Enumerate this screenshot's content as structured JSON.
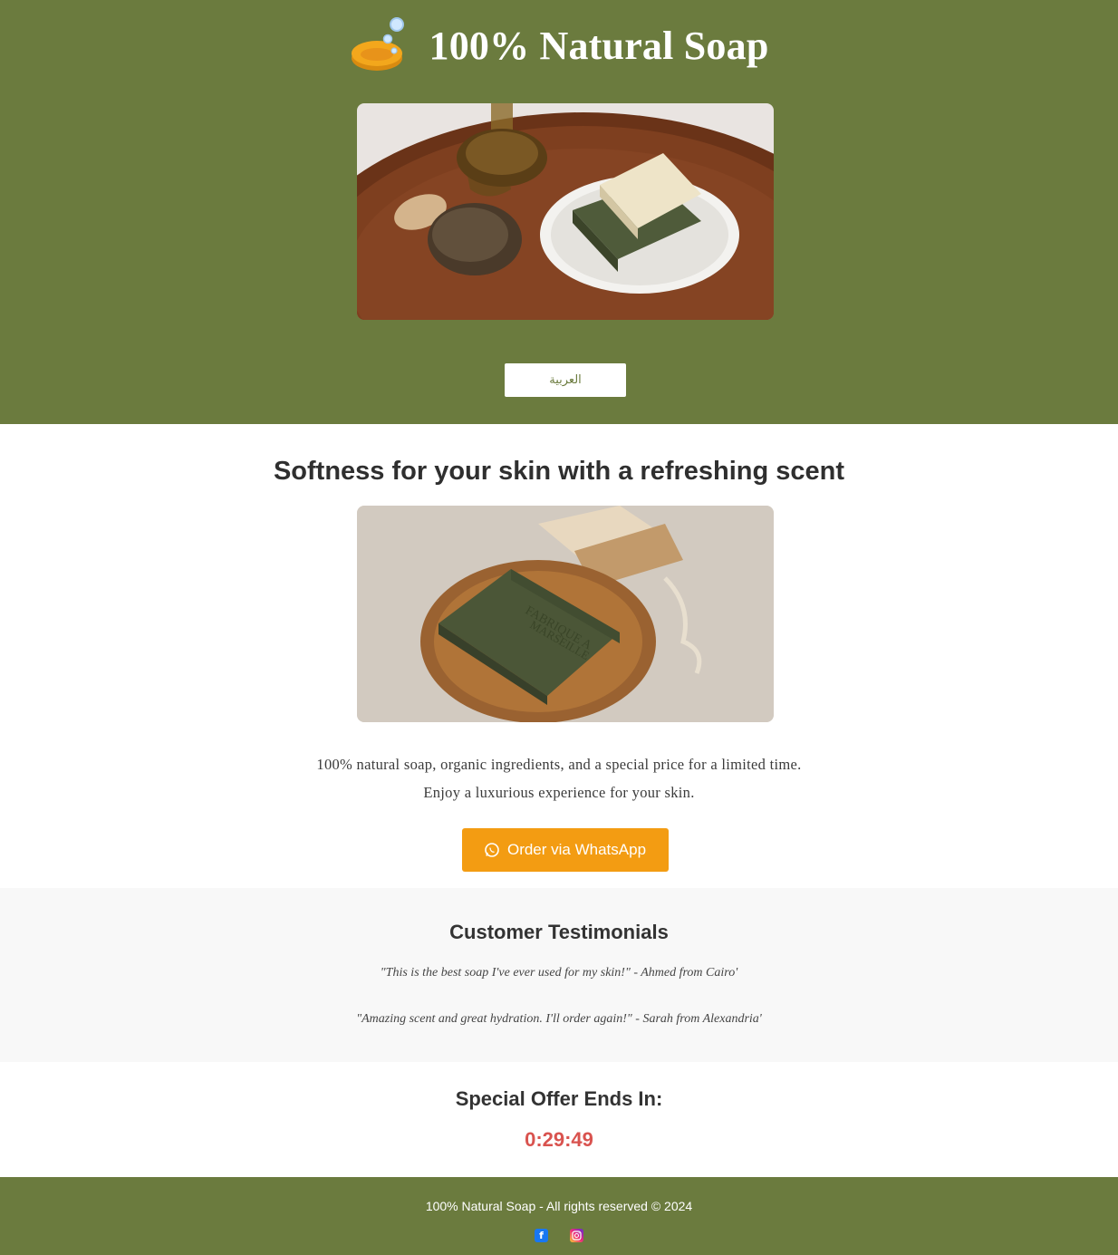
{
  "header": {
    "title": "100% Natural Soap",
    "language_button": "العربية",
    "logo_icon": "soap-bar-icon"
  },
  "main": {
    "title": "Softness for your skin with a refreshing scent",
    "description_line1": "100% natural soap, organic ingredients, and a special price for a limited time.",
    "description_line2": "Enjoy a luxurious experience for your skin.",
    "order_button": "Order via WhatsApp",
    "order_icon": "whatsapp-icon"
  },
  "testimonials": {
    "title": "Customer Testimonials",
    "items": [
      "\"This is the best soap I've ever used for my skin!\" - Ahmed from Cairo'",
      "\"Amazing scent and great hydration. I'll order again!\" - Sarah from Alexandria'"
    ]
  },
  "offer": {
    "title": "Special Offer Ends In:",
    "countdown": "0:29:49"
  },
  "footer": {
    "text": "100% Natural Soap - All rights reserved © 2024",
    "social_icons": [
      "facebook-icon",
      "instagram-icon"
    ]
  },
  "colors": {
    "brand_green": "#6b7b3e",
    "accent_orange": "#f39c12",
    "countdown_red": "#d9534f"
  }
}
